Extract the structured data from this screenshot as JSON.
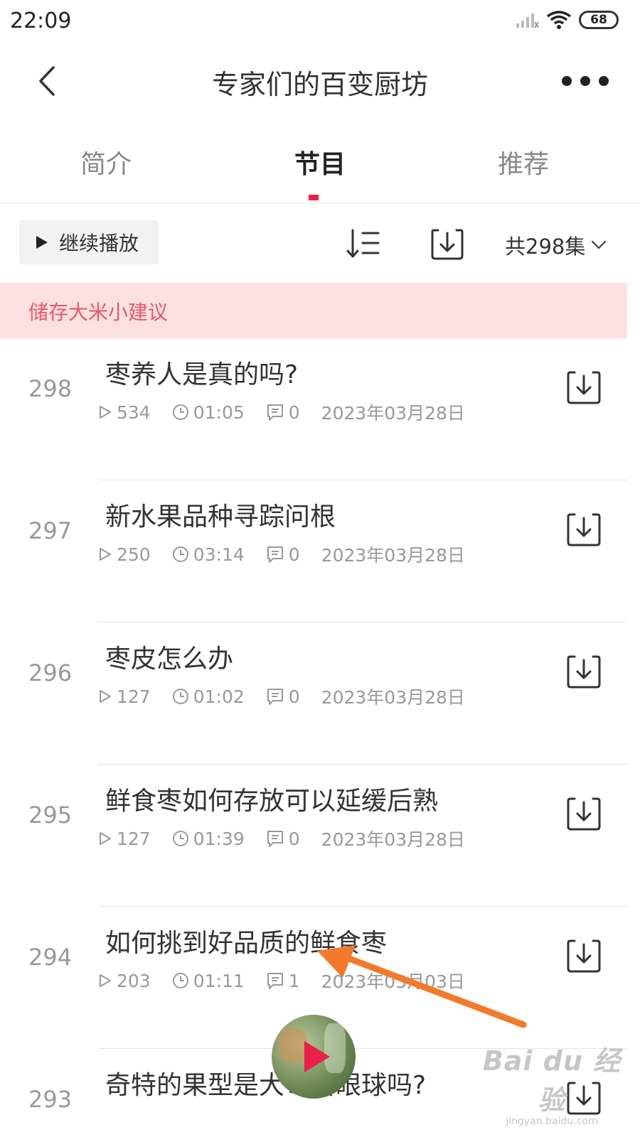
{
  "status_bar": {
    "time": "22:09",
    "battery": "68",
    "icons": [
      "signal-icon",
      "wifi-icon",
      "battery-icon"
    ]
  },
  "nav": {
    "title": "专家们的百变厨坊",
    "back_icon": "chevron-left-icon",
    "more_icon": "more-dots-icon"
  },
  "tabs": [
    {
      "label": "简介",
      "active": false
    },
    {
      "label": "节目",
      "active": true
    },
    {
      "label": "推荐",
      "active": false
    }
  ],
  "toolbar": {
    "continue_label": "继续播放",
    "episode_count": "共298集",
    "sort_icon": "sort-icon",
    "download_icon": "download-icon"
  },
  "tip": {
    "text": "储存大米小建议"
  },
  "episodes": [
    {
      "num": "298",
      "title": "枣养人是真的吗?",
      "plays": "534",
      "duration": "01:05",
      "comments": "0",
      "date": "2023年03月28日"
    },
    {
      "num": "297",
      "title": "新水果品种寻踪问根",
      "plays": "250",
      "duration": "03:14",
      "comments": "0",
      "date": "2023年03月28日"
    },
    {
      "num": "296",
      "title": "枣皮怎么办",
      "plays": "127",
      "duration": "01:02",
      "comments": "0",
      "date": "2023年03月28日"
    },
    {
      "num": "295",
      "title": "鲜食枣如何存放可以延缓后熟",
      "plays": "127",
      "duration": "01:39",
      "comments": "0",
      "date": "2023年03月28日"
    },
    {
      "num": "294",
      "title": "如何挑到好品质的鲜食枣",
      "plays": "203",
      "duration": "01:11",
      "comments": "1",
      "date": "2023年03月03日"
    },
    {
      "num": "293",
      "title": "奇特的果型是大枣引眼球吗?",
      "plays": "",
      "duration": "",
      "comments": "",
      "date": ""
    }
  ],
  "watermark": {
    "logo": "Bai du 经验",
    "url": "jingyan.baidu.com"
  },
  "colors": {
    "accent": "#e8204a",
    "banner_bg": "#fde0e0",
    "banner_text": "#e45a6a",
    "annotation_arrow": "#f37a2a"
  }
}
